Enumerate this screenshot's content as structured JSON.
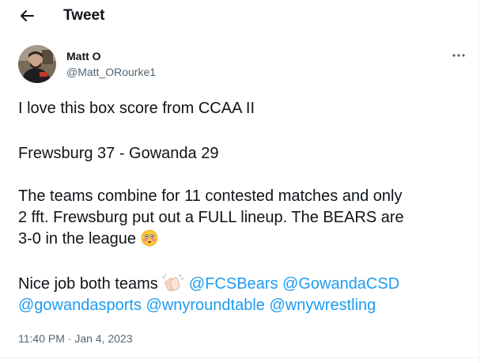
{
  "header": {
    "title": "Tweet",
    "back_icon": "arrow-left-icon"
  },
  "author": {
    "name": "Matt O",
    "handle": "@Matt_ORourke1"
  },
  "menu": {
    "icon": "more-horizontal-icon",
    "glyph": "···"
  },
  "tweet": {
    "line1": "I love this box score from CCAA II",
    "line2": "Frewsburg 37 - Gowanda 29",
    "line3": "The teams combine for 11 contested matches and only",
    "line4": "2 fft. Frewsburg put out a FULL lineup. The BEARS are",
    "line5": "3-0 in the league",
    "line5_emoji": "flushed-face-emoji",
    "line6_text": "Nice job both teams",
    "line6_emoji": "clapping-hands-emoji",
    "mentions": [
      "@FCSBears",
      "@GowandaCSD",
      "@gowandasports",
      "@wnyroundtable",
      "@wnywrestling"
    ]
  },
  "timestamp": "11:40 PM · Jan 4, 2023",
  "colors": {
    "link": "#1d9bf0",
    "text": "#0f1419",
    "secondary": "#536471",
    "divider": "#eff3f4"
  }
}
